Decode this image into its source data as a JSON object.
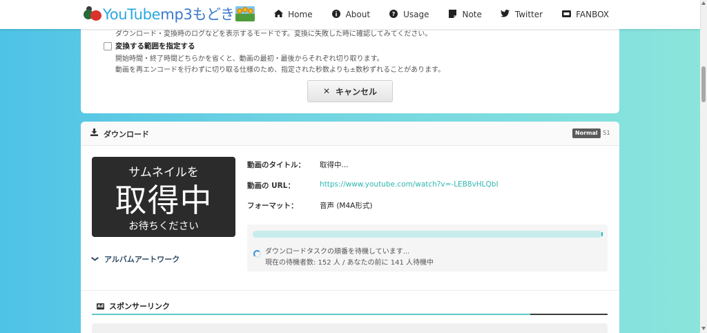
{
  "header": {
    "logo_text_a": "YouTube",
    "logo_text_b": "mp3もどき",
    "nav": [
      {
        "label": "Home",
        "icon": "home-icon",
        "glyph": "⌂"
      },
      {
        "label": "About",
        "icon": "info-icon",
        "glyph": "ℹ"
      },
      {
        "label": "Usage",
        "icon": "question-icon",
        "glyph": "?"
      },
      {
        "label": "Note",
        "icon": "note-icon",
        "glyph": "▪"
      },
      {
        "label": "Twitter",
        "icon": "twitter-icon",
        "glyph": "🐦"
      },
      {
        "label": "FANBOX",
        "icon": "fanbox-icon",
        "glyph": "▭"
      }
    ]
  },
  "settings": {
    "log_mode_desc": "ダウンロード・変換時のログなどを表示するモードです。変換に失敗した時に確認してみてください。",
    "range_label": "変換する範囲を指定する",
    "range_desc_1": "開始時間・終了時間どちらかを省くと、動画の最初・最後からそれぞれ切り取ります。",
    "range_desc_2": "動画を再エンコードを行わずに切り取る仕様のため、指定された秒数よりも±数秒ずれることがあります。",
    "cancel_label": "キャンセル"
  },
  "download": {
    "title": "ダウンロード",
    "badge": "Normal",
    "server": "S1",
    "thumb_line1": "サムネイルを",
    "thumb_line2": "取得中",
    "thumb_line3": "お待ちください",
    "album_artwork": "アルバムアートワーク",
    "video_title_label": "動画のタイトル：",
    "video_title_value": "取得中...",
    "video_url_label": "動画の URL：",
    "video_url_value": "https://www.youtube.com/watch?v=-LEB8vHLQbI",
    "format_label": "フォーマット：",
    "format_value": "音声 (M4A形式)",
    "progress": 1.0,
    "status_line1": "ダウンロードタスクの順番を待機しています...",
    "status_line2": "現在の待機者数: 152 人 / あなたの前に 141 人待機中"
  },
  "sponsor": {
    "title": "スポンサーリンク",
    "ad_icon": "Ad"
  },
  "colors": {
    "accent": "#2fb7b0",
    "logo_blue": "#29a8e0",
    "badge_bg": "#5a5a5a",
    "bg_left": "#4ec3e6",
    "bg_right": "#8be5dc"
  }
}
